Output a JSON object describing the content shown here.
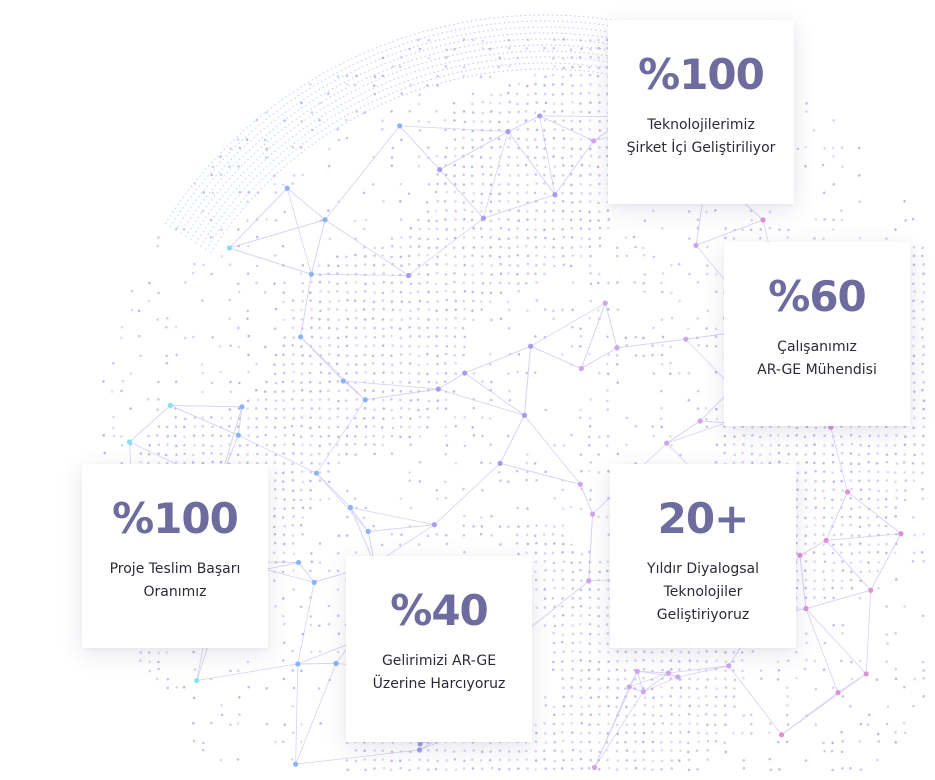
{
  "theme": {
    "value_color": "#6e6c9e",
    "text_color": "#2b2b35",
    "globe_colors": [
      "#7fe3f5",
      "#8ab4f8",
      "#a79cf0",
      "#cfa4ec",
      "#e38fd8"
    ]
  },
  "background": {
    "icon": "world-globe-network-graphic"
  },
  "stats": [
    {
      "value": "%100",
      "lines": [
        "Teknolojilerimiz",
        "Şirket İçi Geliştiriliyor"
      ]
    },
    {
      "value": "%60",
      "lines": [
        "Çalışanımız",
        "AR-GE Mühendisi"
      ]
    },
    {
      "value": "%100",
      "lines": [
        "Proje Teslim Başarı",
        "Oranımız"
      ]
    },
    {
      "value": "%40",
      "lines": [
        "Gelirimizi AR-GE",
        "Üzerine Harcıyoruz"
      ]
    },
    {
      "value": "20+",
      "lines": [
        "Yıldır Diyalogsal",
        "Teknolojiler",
        "Geliştiriyoruz"
      ]
    }
  ]
}
